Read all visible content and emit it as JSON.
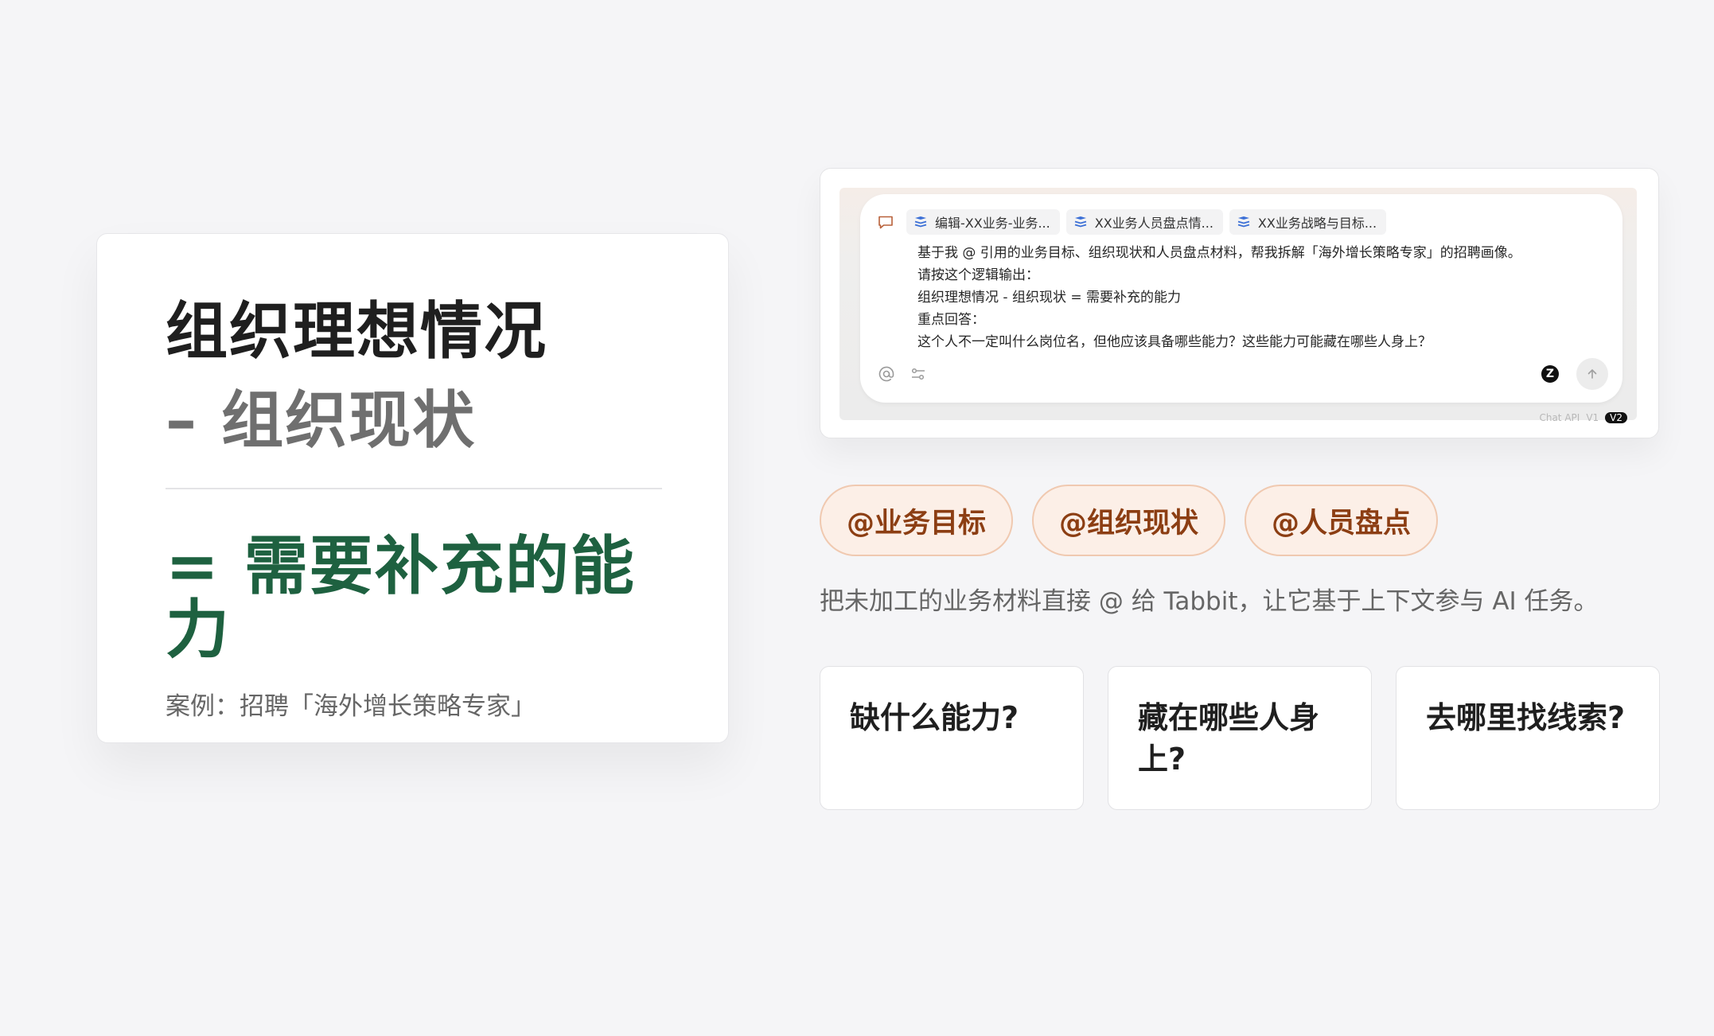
{
  "formula": {
    "line1": "组织理想情况",
    "line2": "– 组织现状",
    "line3": "= 需要补充的能力",
    "case": "案例：招聘「海外增长策略专家」"
  },
  "chat": {
    "attachments": [
      {
        "label": "编辑-XX业务-业务...",
        "icon": "layers-doc-icon"
      },
      {
        "label": "XX业务人员盘点情...",
        "icon": "layers-doc-icon"
      },
      {
        "label": "XX业务战略与目标...",
        "icon": "layers-doc-icon"
      }
    ],
    "prompt_lines": [
      "基于我 @ 引用的业务目标、组织现状和人员盘点材料，帮我拆解「海外增长策略专家」的招聘画像。",
      "请按这个逻辑输出：",
      "组织理想情况 - 组织现状 = 需要补充的能力",
      "重点回答：",
      "这个人不一定叫什么岗位名，但他应该具备哪些能力？这些能力可能藏在哪些人身上？"
    ],
    "model_badge": "Z",
    "footer_peek": {
      "left": "Chat API",
      "mid": "V1",
      "pill": "V2"
    }
  },
  "tags": [
    "@业务目标",
    "@组织现状",
    "@人员盘点"
  ],
  "description": "把未加工的业务材料直接 @ 给 Tabbit，让它基于上下文参与 AI 任务。",
  "questions": [
    "缺什么能力?",
    "藏在哪些人身上?",
    "去哪里找线索?"
  ],
  "colors": {
    "accent_green": "#1e6140",
    "tag_text": "#8c3e13",
    "tag_bg": "#fcefe7",
    "tag_border": "#f0c9b0",
    "doc_icon_blue": "#3b6fd6"
  }
}
